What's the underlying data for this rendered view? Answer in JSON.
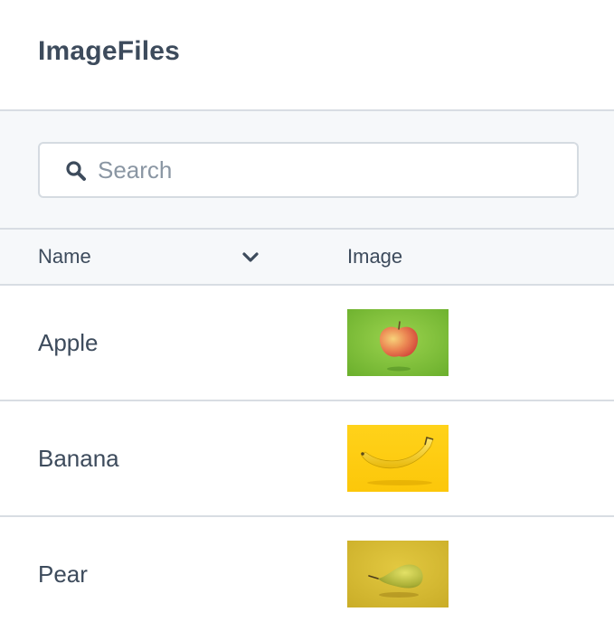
{
  "app": {
    "title": "ImageFiles"
  },
  "search": {
    "placeholder": "Search",
    "value": ""
  },
  "table": {
    "columns": [
      {
        "label": "Name",
        "sort_icon": "chevron-down-icon"
      },
      {
        "label": "Image"
      }
    ],
    "rows": [
      {
        "name": "Apple",
        "image": "apple-thumbnail"
      },
      {
        "name": "Banana",
        "image": "banana-thumbnail"
      },
      {
        "name": "Pear",
        "image": "pear-thumbnail"
      }
    ]
  },
  "colors": {
    "text": "#3d4b5c",
    "border": "#d8dde3",
    "band_background": "#f6f8fa",
    "placeholder": "#8a96a3"
  }
}
